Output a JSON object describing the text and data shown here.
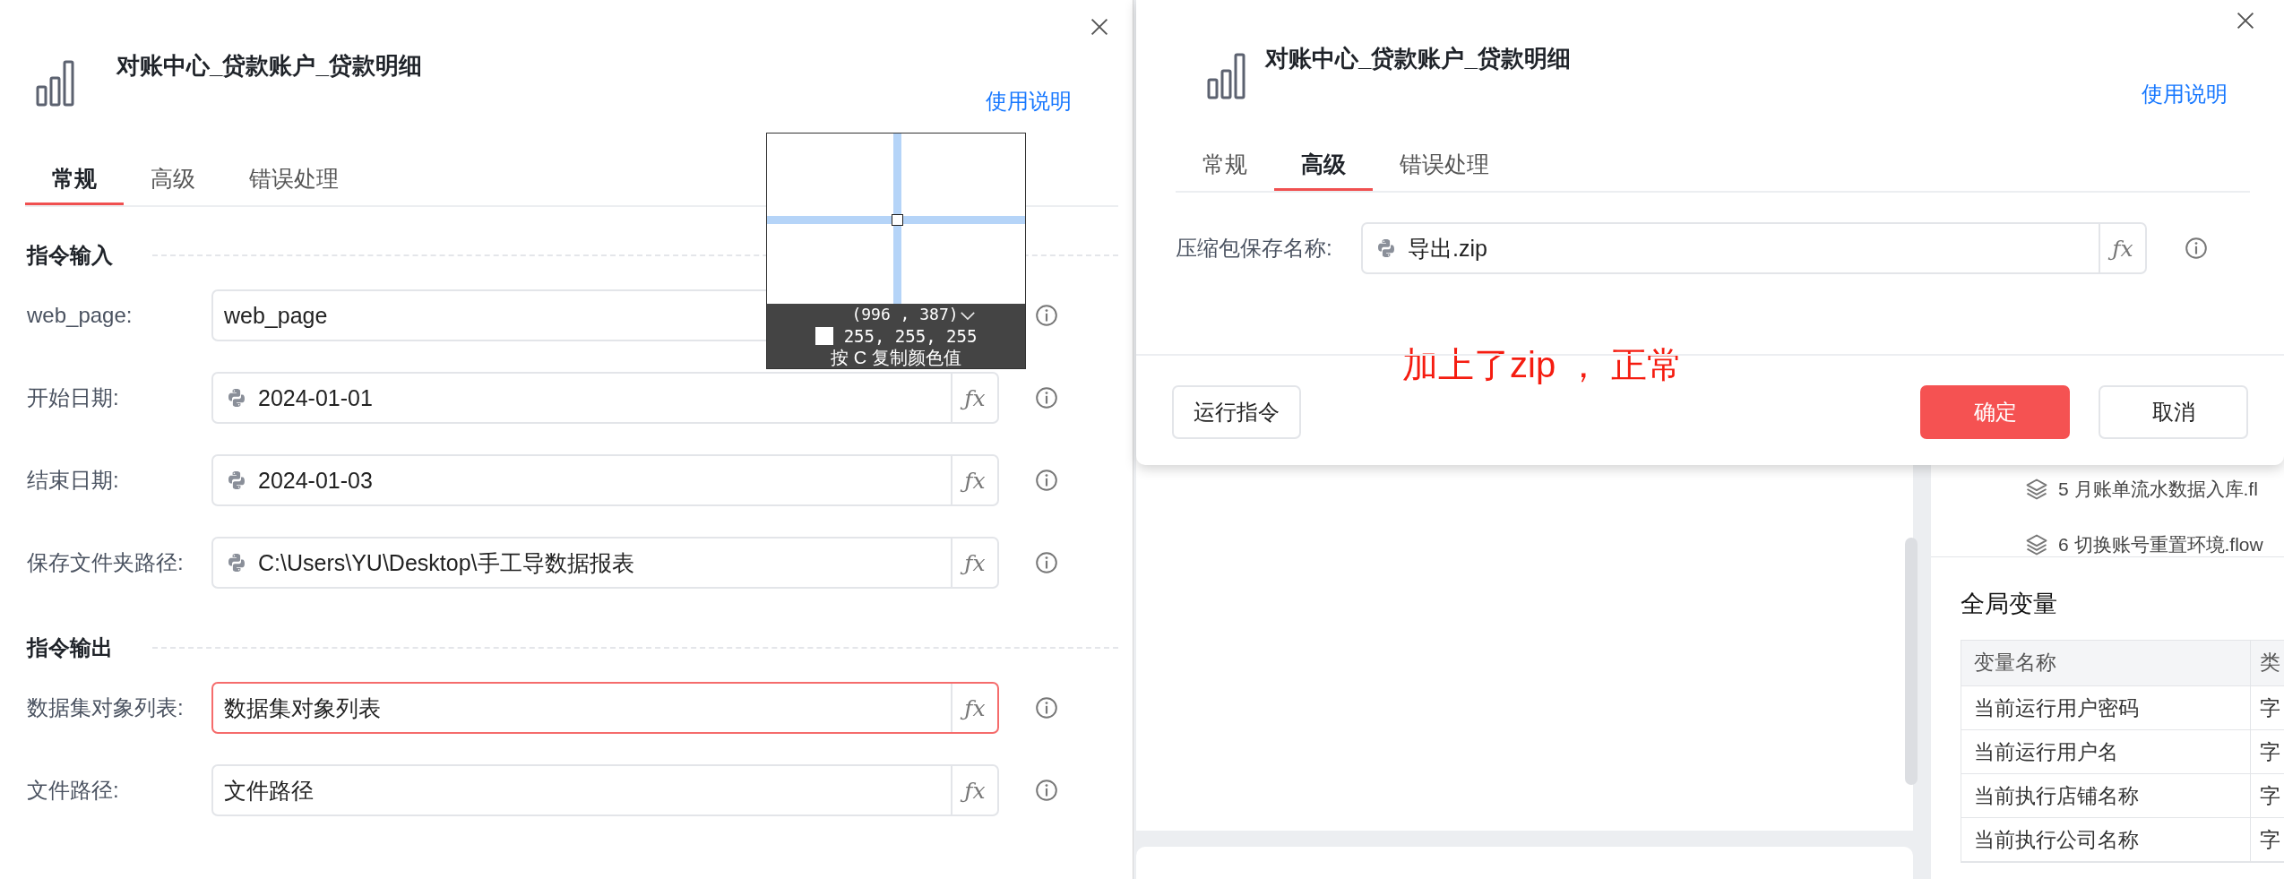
{
  "dialogs": [
    {
      "title": "对账中心_贷款账户_贷款明细",
      "help_link": "使用说明",
      "tabs": [
        {
          "label": "常规",
          "selected": true
        },
        {
          "label": "高级",
          "selected": false
        },
        {
          "label": "错误处理",
          "selected": false
        }
      ],
      "sections": [
        {
          "title": "指令输入",
          "fields": [
            {
              "label": "web_page:",
              "value": "web_page",
              "kind": "select",
              "error": false
            },
            {
              "label": "开始日期:",
              "value": "2024-01-01",
              "kind": "python",
              "error": false,
              "formula": "ƒx"
            },
            {
              "label": "结束日期:",
              "value": "2024-01-03",
              "kind": "python",
              "error": false,
              "formula": "ƒx"
            },
            {
              "label": "保存文件夹路径:",
              "value": "C:\\Users\\YU\\Desktop\\手工导数据报表",
              "kind": "python",
              "error": false,
              "formula": "ƒx"
            }
          ]
        },
        {
          "title": "指令输出",
          "fields": [
            {
              "label": "数据集对象列表:",
              "value": "数据集对象列表",
              "kind": "plain",
              "error": true,
              "formula": "ƒx"
            },
            {
              "label": "文件路径:",
              "value": "文件路径",
              "kind": "plain",
              "error": false,
              "formula": "ƒx"
            }
          ]
        }
      ]
    },
    {
      "title": "对账中心_贷款账户_贷款明细",
      "help_link": "使用说明",
      "tabs": [
        {
          "label": "常规",
          "selected": false
        },
        {
          "label": "高级",
          "selected": true
        },
        {
          "label": "错误处理",
          "selected": false
        }
      ],
      "sections": [
        {
          "fields": [
            {
              "label": "压缩包保存名称:",
              "value": "导出.zip",
              "kind": "python",
              "error": false,
              "formula": "ƒx"
            }
          ]
        }
      ],
      "annotation": "加上了zip ， 正常",
      "buttons": [
        {
          "label": "运行指令",
          "kind": "default"
        },
        {
          "label": "确定",
          "kind": "primary"
        },
        {
          "label": "取消",
          "kind": "default"
        }
      ]
    }
  ],
  "color_picker": {
    "coords": "(996 , 387)",
    "rgb": "255, 255, 255",
    "hint": "按 C 复制颜色值"
  },
  "side_panel": {
    "flows": [
      "5 月账单流水数据入库.fl",
      "6 切换账号重置环境.flow"
    ],
    "globals_title": "全局变量",
    "columns": [
      "变量名称",
      "类"
    ],
    "rows": [
      [
        "当前运行用户密码",
        "字"
      ],
      [
        "当前运行用户名",
        "字"
      ],
      [
        "当前执行店铺名称",
        "字"
      ],
      [
        "当前执行公司名称",
        "字"
      ]
    ]
  }
}
